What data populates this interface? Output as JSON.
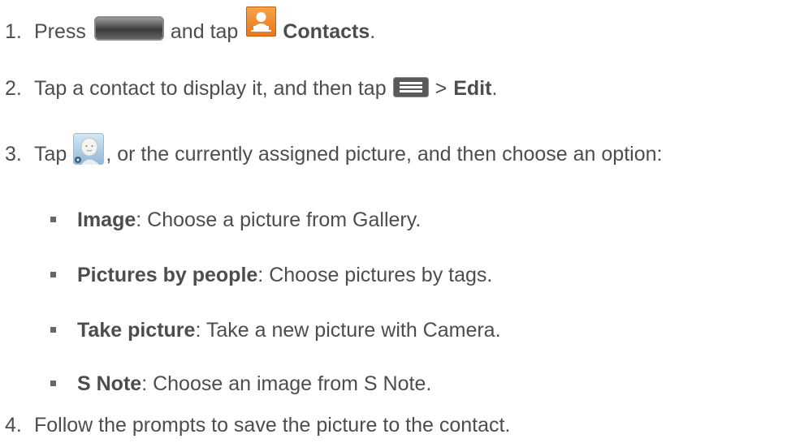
{
  "steps": [
    {
      "num": "1.",
      "parts": {
        "pre": "Press",
        "mid": "and tap",
        "bold": "Contacts",
        "post": "."
      },
      "icons": [
        "home-key-icon",
        "contacts-icon"
      ]
    },
    {
      "num": "2.",
      "parts": {
        "pre": "Tap a contact to display it, and then tap",
        "mid": ">",
        "bold": "Edit",
        "post": "."
      },
      "icons": [
        "menu-key-icon"
      ]
    },
    {
      "num": "3.",
      "parts": {
        "pre": "Tap",
        "post": ", or the currently assigned picture, and then choose an option:"
      },
      "icons": [
        "contact-photo-icon"
      ]
    },
    {
      "num": "4.",
      "parts": {
        "pre": "Follow the prompts to save the picture to the contact."
      }
    }
  ],
  "options": [
    {
      "title": "Image",
      "desc": ": Choose a picture from Gallery."
    },
    {
      "title": "Pictures by people",
      "desc": ": Choose pictures by tags."
    },
    {
      "title": "Take picture",
      "desc": ": Take a new picture with Camera."
    },
    {
      "title": "S Note",
      "desc": ": Choose an image from S Note."
    }
  ],
  "colors": {
    "text": "#4d4d4d",
    "contacts_icon": "#f0861f"
  }
}
